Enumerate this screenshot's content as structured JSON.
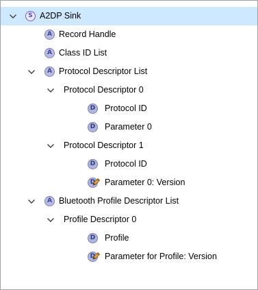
{
  "tree": {
    "root": {
      "label": "A2DP Sink",
      "icon": "service-icon",
      "icon_letter": "S",
      "expanded": true,
      "selected": true
    },
    "record_handle": {
      "label": "Record Handle",
      "icon_letter": "A"
    },
    "class_id_list": {
      "label": "Class ID List",
      "icon_letter": "A"
    },
    "protocol_descriptor_list": {
      "label": "Protocol Descriptor List",
      "icon_letter": "A",
      "expanded": true,
      "descriptor_0": {
        "label": "Protocol Descriptor 0",
        "expanded": true,
        "protocol_id": {
          "label": "Protocol ID",
          "icon_letter": "D"
        },
        "parameter_0": {
          "label": "Parameter 0",
          "icon_letter": "D"
        }
      },
      "descriptor_1": {
        "label": "Protocol Descriptor 1",
        "expanded": true,
        "protocol_id": {
          "label": "Protocol ID",
          "icon_letter": "D"
        },
        "parameter_0_version": {
          "label": "Parameter 0: Version",
          "icon_letter": "D",
          "icon": "data-element-edit-icon"
        }
      }
    },
    "bluetooth_profile_descriptor_list": {
      "label": "Bluetooth Profile Descriptor List",
      "icon_letter": "A",
      "expanded": true,
      "profile_descriptor_0": {
        "label": "Profile Descriptor 0",
        "expanded": true,
        "profile": {
          "label": "Profile",
          "icon_letter": "D"
        },
        "parameter_for_profile_version": {
          "label": "Parameter for Profile: Version",
          "icon_letter": "D",
          "icon": "data-element-edit-icon"
        }
      }
    }
  },
  "colors": {
    "selection_background": "#cde8ff",
    "service_icon": "#6b5bd8",
    "attribute_icon": "#b7bde6",
    "data_icon": "#aeb5e0",
    "edit_pencil": "#e0a030"
  }
}
